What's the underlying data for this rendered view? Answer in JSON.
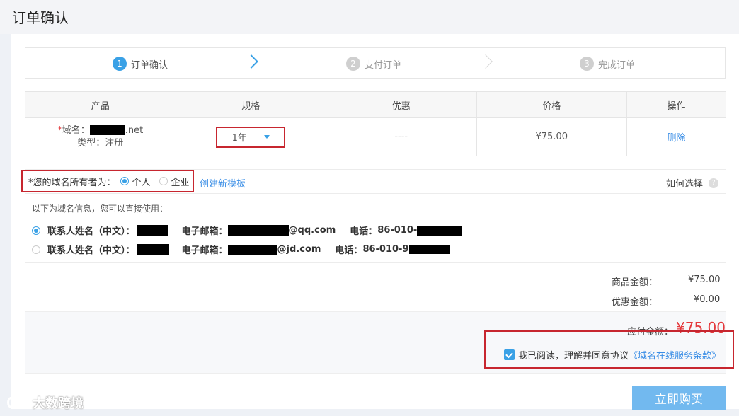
{
  "page": {
    "title": "订单确认"
  },
  "steps": [
    {
      "num": "1",
      "label": "订单确认"
    },
    {
      "num": "2",
      "label": "支付订单"
    },
    {
      "num": "3",
      "label": "完成订单"
    }
  ],
  "table": {
    "headers": [
      "产品",
      "规格",
      "优惠",
      "价格",
      "操作"
    ],
    "row": {
      "domain_star": "*",
      "domain_label": "域名：",
      "domain_suffix": ".net",
      "type": "类型：注册",
      "spec": "1年",
      "discount": "----",
      "price": "¥75.00",
      "action": "删除"
    }
  },
  "owner": {
    "label": "*您的域名所有者为：",
    "options": [
      "个人",
      "企业"
    ],
    "selected": "个人",
    "new_template": "创建新模板",
    "how_to": "如何选择",
    "info_hint": "以下为域名信息，您可以直接使用：",
    "contacts": [
      {
        "name_label": "联系人姓名（中文）：",
        "email_label": "电子邮箱：",
        "email_suffix": "@qq.com",
        "phone_label": "电话：",
        "phone_prefix": "86-010-",
        "selected": true
      },
      {
        "name_label": "联系人姓名（中文）：",
        "email_label": "电子邮箱：",
        "email_suffix": "@jd.com",
        "phone_label": "电话：",
        "phone_prefix": "86-010-9",
        "selected": false
      }
    ]
  },
  "totals": {
    "goods_label": "商品金额：",
    "goods_value": "¥75.00",
    "discount_label": "优惠金额：",
    "discount_value": "¥0.00",
    "payable_label": "应付金额：",
    "payable_value": "¥75.00"
  },
  "agreement": {
    "text": "我已阅读，理解并同意协议",
    "link": "《域名在线服务条款》",
    "checked": true
  },
  "buy_button": "立即购买",
  "watermark": "大数跨境",
  "colors": {
    "accent": "#3aa1e6",
    "highlight_red": "#c7262f",
    "price_red": "#e4393c"
  }
}
